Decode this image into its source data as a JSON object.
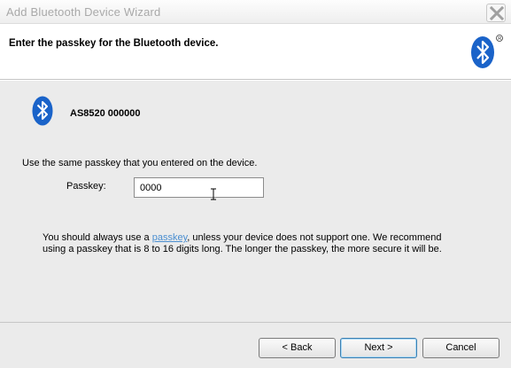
{
  "window": {
    "title": "Add Bluetooth Device Wizard"
  },
  "header": {
    "title": "Enter the passkey for the Bluetooth device."
  },
  "icons": {
    "close": "close-icon",
    "logo": "bluetooth-logo-icon",
    "device": "bluetooth-icon",
    "cursor": "text-cursor-icon"
  },
  "colors": {
    "bluetooth_blue": "#1a63c9",
    "link": "#4a8ed0"
  },
  "device": {
    "name": "AS8520  000000"
  },
  "instruction": "Use the same passkey that you entered on the device.",
  "passkey": {
    "label": "Passkey:",
    "value": "0000"
  },
  "note": {
    "before": "You should always use a ",
    "link": "passkey",
    "after": ", unless your device does not support one. We recommend using a passkey that is 8 to 16 digits long. The longer the passkey, the more secure it will be."
  },
  "buttons": {
    "back": "< Back",
    "next": "Next >",
    "cancel": "Cancel"
  }
}
